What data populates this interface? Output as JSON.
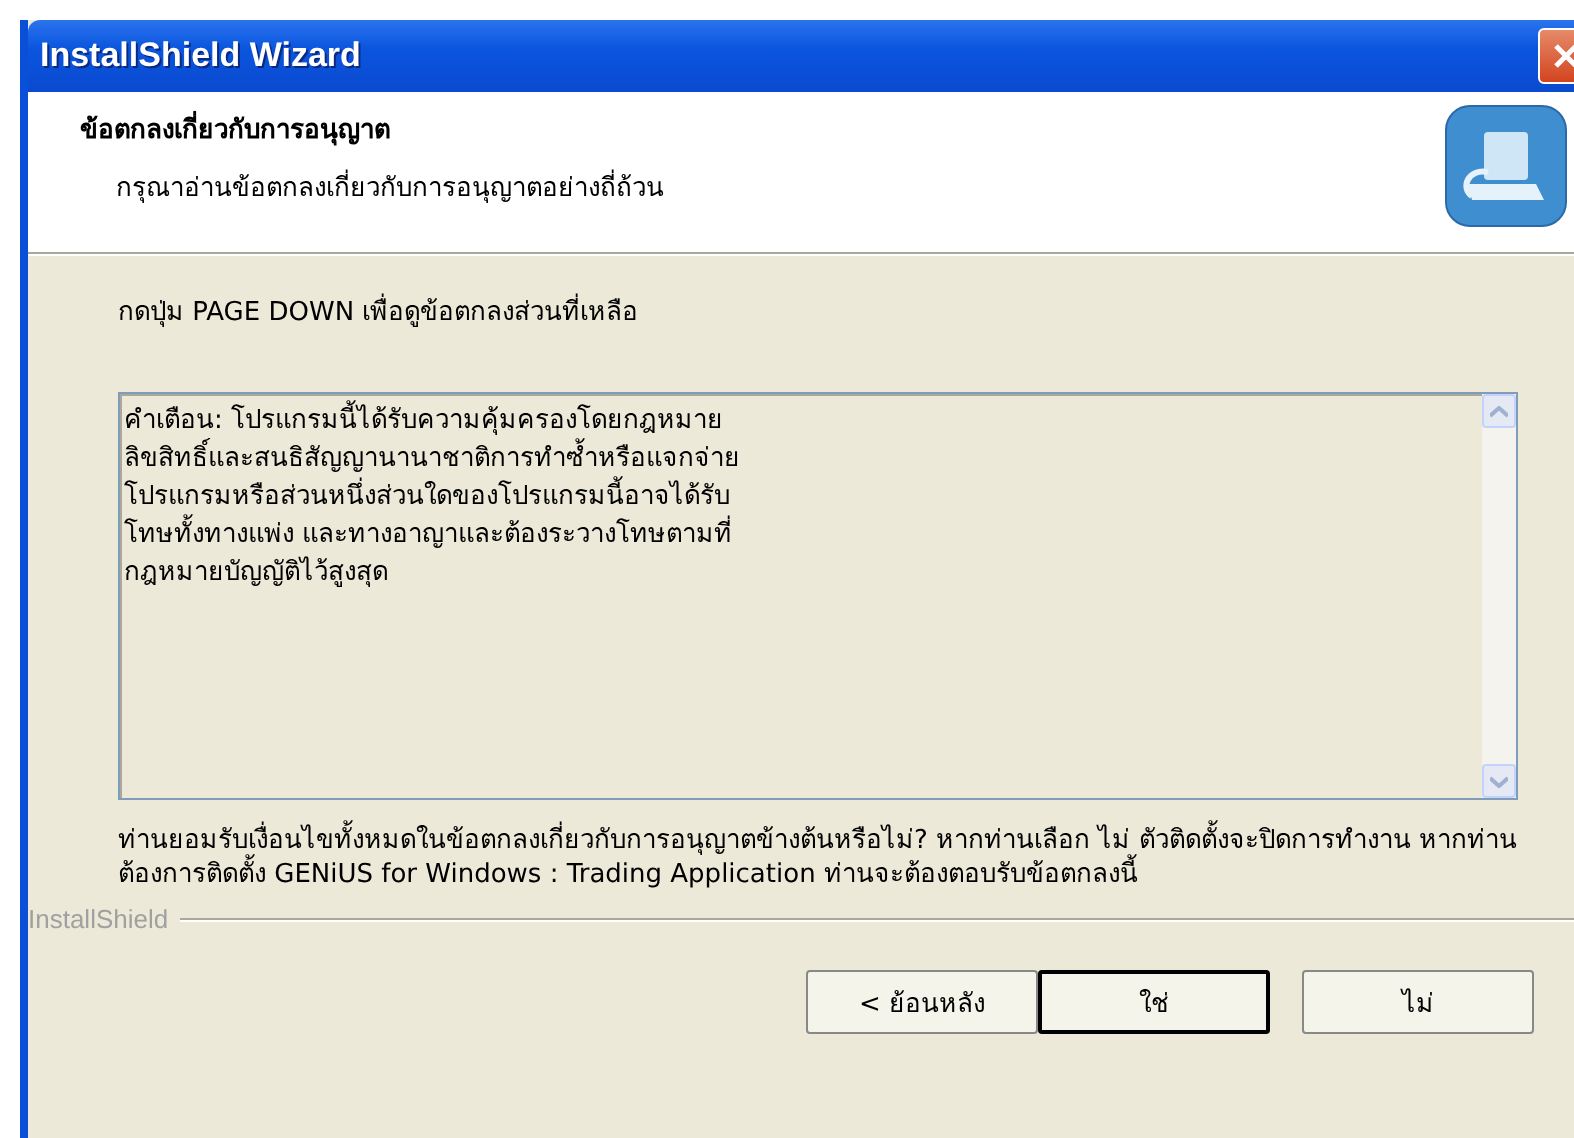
{
  "window": {
    "title": "InstallShield Wizard"
  },
  "header": {
    "title": "ข้อตกลงเกี่ยวกับการอนุญาต",
    "subtitle": "กรุณาอ่านข้อตกลงเกี่ยวกับการอนุญาตอย่างถี่ถ้วน"
  },
  "instruction": "กดปุ่ม PAGE DOWN เพื่อดูข้อตกลงส่วนที่เหลือ",
  "license_text": [
    "คำเตือน: โปรแกรมนี้ได้รับความคุ้มครองโดยกฎหมาย",
    "ลิขสิทธิ์และสนธิสัญญานานาชาติการทำซ้ำหรือแจกจ่าย",
    "โปรแกรมหรือส่วนหนึ่งส่วนใดของโปรแกรมนี้อาจได้รับ",
    "โทษทั้งทางแพ่ง และทางอาญาและต้องระวางโทษตามที่",
    "กฎหมายบัญญัติไว้สูงสุด"
  ],
  "question": "ท่านยอมรับเงื่อนไขทั้งหมดในข้อตกลงเกี่ยวกับการอนุญาตข้างต้นหรือไม่?  หากท่านเลือก ไม่ ตัวติดตั้งจะปิดการทำงาน  หากท่านต้องการติดตั้ง GENiUS for Windows : Trading Application  ท่านจะต้องตอบรับข้อตกลงนี้",
  "brand": "InstallShield",
  "buttons": [
    {
      "label": "< ย้อนหลัง",
      "default": false
    },
    {
      "label": "ใช่",
      "default": true
    },
    {
      "label": "ไม่",
      "default": false
    }
  ]
}
